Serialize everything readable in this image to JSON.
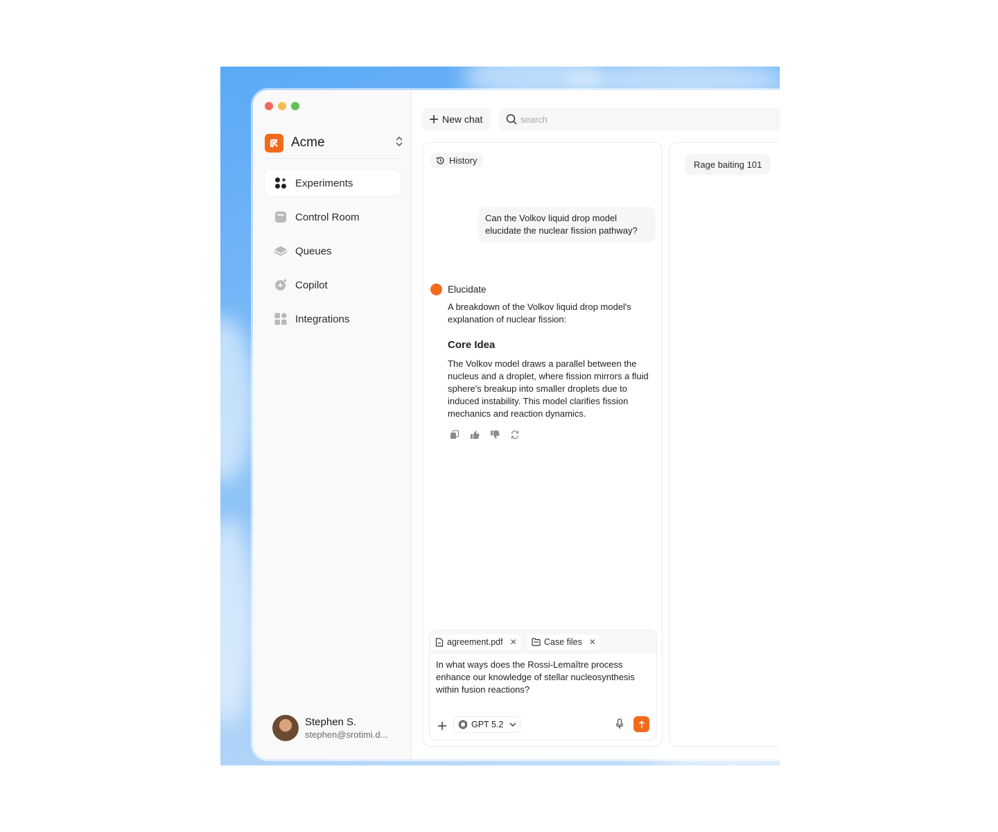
{
  "window": {
    "traffic_lights": [
      "#ef6a5e",
      "#f4bd4f",
      "#5fc454"
    ]
  },
  "brand": {
    "name": "Acme",
    "accent": "#f26a1b",
    "switch_icon": "chevron-up-down-icon"
  },
  "sidebar": {
    "items": [
      {
        "label": "Experiments",
        "icon": "experiments-icon",
        "active": true
      },
      {
        "label": "Control Room",
        "icon": "control-room-icon",
        "active": false
      },
      {
        "label": "Queues",
        "icon": "stack-icon",
        "active": false
      },
      {
        "label": "Copilot",
        "icon": "copilot-icon",
        "active": false
      },
      {
        "label": "Integrations",
        "icon": "grid-icon",
        "active": false
      }
    ]
  },
  "user": {
    "name": "Stephen S.",
    "email": "stephen@srotimi.d..."
  },
  "toolbar": {
    "new_chat_label": "New chat",
    "search_placeholder": "search"
  },
  "chat": {
    "history_label": "History",
    "user_message": "Can the Volkov liquid drop model elucidate the nuclear fission pathway?",
    "assistant_name": "Elucidate",
    "assistant_intro": "A breakdown of the Volkov liquid drop model's explanation of nuclear fission:",
    "section_heading": "Core Idea",
    "section_body": "The Volkov model draws a parallel between the nucleus and a droplet, where fission mirrors a fluid sphere's breakup into smaller droplets due to induced instability. This model clarifies fission mechanics and reaction dynamics.",
    "actions": [
      "copy-icon",
      "thumbs-up-icon",
      "thumbs-down-icon",
      "regenerate-icon"
    ]
  },
  "composer": {
    "attachments": [
      {
        "label": "agreement.pdf",
        "icon": "file-icon"
      },
      {
        "label": "Case files",
        "icon": "folder-icon"
      }
    ],
    "text": "In what ways does the Rossi-Lemaître process enhance our knowledge of stellar nucleosynthesis within fusion reactions?",
    "model_label": "GPT 5.2"
  },
  "second_panel": {
    "chip_label": "Rage baiting 101"
  }
}
